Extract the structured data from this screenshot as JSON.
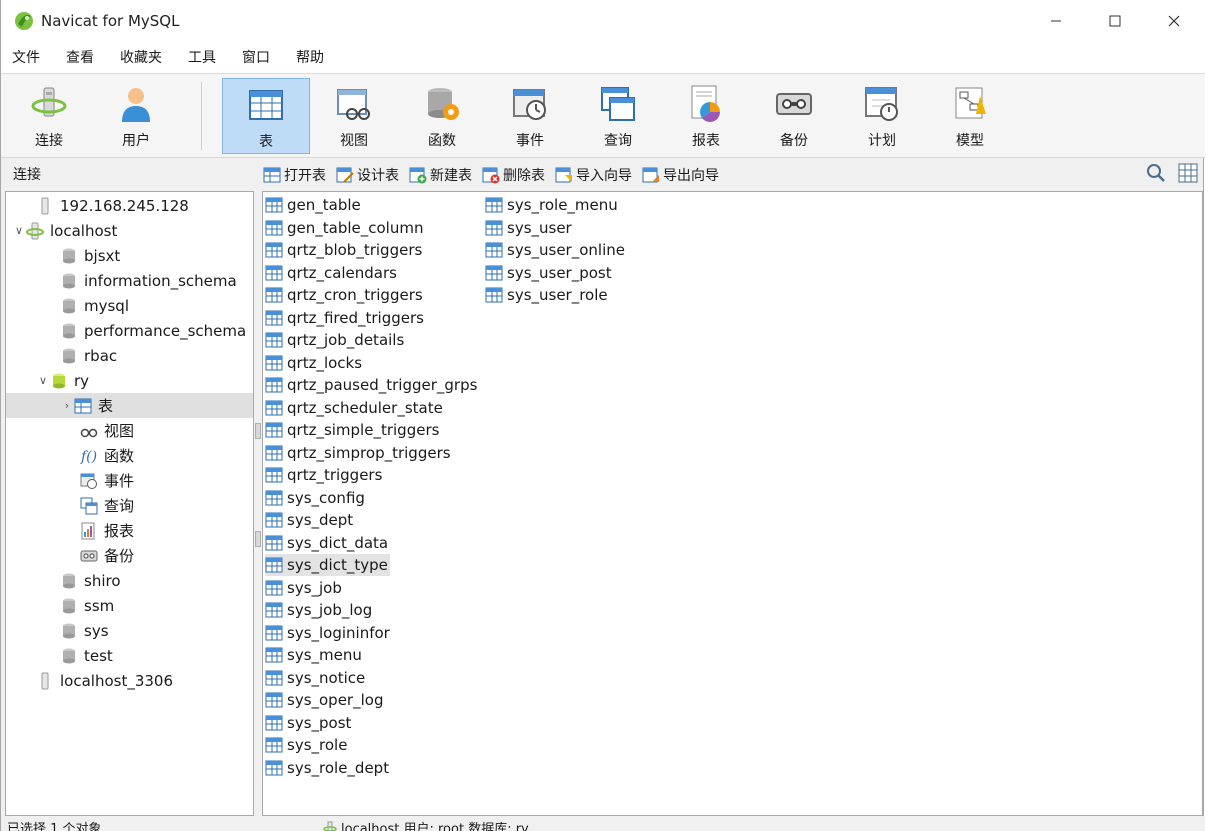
{
  "window": {
    "title": "Navicat for MySQL"
  },
  "menubar": [
    "文件",
    "查看",
    "收藏夹",
    "工具",
    "窗口",
    "帮助"
  ],
  "toolbar": {
    "connect": "连接",
    "user": "用户",
    "table": "表",
    "view": "视图",
    "function": "函数",
    "event": "事件",
    "query": "查询",
    "report": "报表",
    "backup": "备份",
    "schedule": "计划",
    "model": "模型"
  },
  "connections_label": "连接",
  "object_toolbar": {
    "open": "打开表",
    "design": "设计表",
    "new": "新建表",
    "delete": "删除表",
    "import": "导入向导",
    "export": "导出向导"
  },
  "tree": {
    "conn1": "192.168.245.128",
    "localhost": "localhost",
    "db_bjsxt": "bjsxt",
    "db_information_schema": "information_schema",
    "db_mysql": "mysql",
    "db_performance_schema": "performance_schema",
    "db_rbac": "rbac",
    "db_ry": "ry",
    "ry_tables": "表",
    "ry_views": "视图",
    "ry_functions": "函数",
    "ry_events": "事件",
    "ry_queries": "查询",
    "ry_reports": "报表",
    "ry_backups": "备份",
    "db_shiro": "shiro",
    "db_ssm": "ssm",
    "db_sys": "sys",
    "db_test": "test",
    "conn3": "localhost_3306"
  },
  "tables": [
    "gen_table",
    "gen_table_column",
    "qrtz_blob_triggers",
    "qrtz_calendars",
    "qrtz_cron_triggers",
    "qrtz_fired_triggers",
    "qrtz_job_details",
    "qrtz_locks",
    "qrtz_paused_trigger_grps",
    "qrtz_scheduler_state",
    "qrtz_simple_triggers",
    "qrtz_simprop_triggers",
    "qrtz_triggers",
    "sys_config",
    "sys_dept",
    "sys_dict_data",
    "sys_dict_type",
    "sys_job",
    "sys_job_log",
    "sys_logininfor",
    "sys_menu",
    "sys_notice",
    "sys_oper_log",
    "sys_post",
    "sys_role",
    "sys_role_dept",
    "sys_role_menu",
    "sys_user",
    "sys_user_online",
    "sys_user_post",
    "sys_user_role"
  ],
  "selected_table": "sys_dict_type",
  "status": {
    "left": "已选择 1 个对象",
    "right": "localhost  用户: root  数据库: ry"
  },
  "colors": {
    "accent": "#bfdcf7",
    "selection": "#e3e3e3"
  }
}
